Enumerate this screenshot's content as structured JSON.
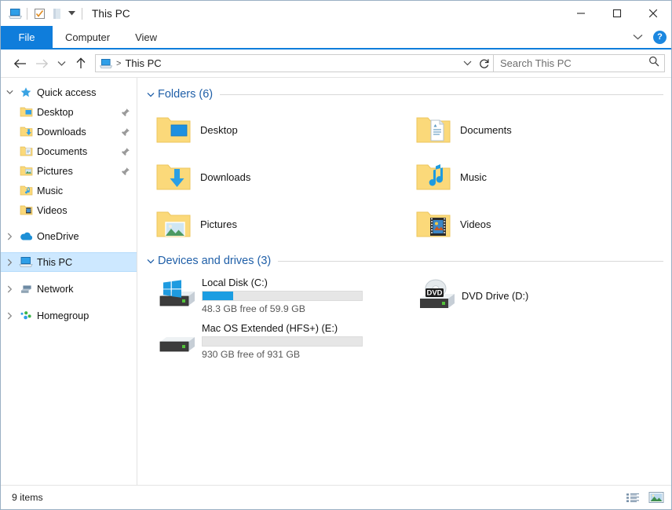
{
  "window": {
    "title": "This PC",
    "quick_access_toolbar": [
      {
        "name": "this-pc-icon",
        "label": "This PC"
      },
      {
        "name": "properties-icon",
        "label": "Properties"
      },
      {
        "name": "new-folder-icon",
        "label": "New folder"
      },
      {
        "name": "customize-chevron-icon",
        "label": "Customize Quick Access Toolbar"
      }
    ],
    "controls": {
      "minimize": "Minimize",
      "maximize": "Maximize",
      "close": "Close"
    }
  },
  "ribbon": {
    "tabs": [
      {
        "label": "File",
        "active": true
      },
      {
        "label": "Computer",
        "active": false
      },
      {
        "label": "View",
        "active": false
      }
    ],
    "expand_label": "Expand the Ribbon",
    "help_label": "?"
  },
  "navigation": {
    "back_label": "Back",
    "forward_label": "Forward",
    "recent_label": "Recent locations",
    "up_label": "Up",
    "breadcrumb": {
      "icon": "this-pc-icon",
      "separator": ">",
      "path": "This PC"
    },
    "address_dropdown_label": "Previous locations",
    "refresh_label": "Refresh"
  },
  "search": {
    "placeholder": "Search This PC",
    "value": "",
    "icon": "search-icon"
  },
  "sidebar": {
    "items": [
      {
        "label": "Quick access",
        "icon": "star-icon",
        "twisty": "down",
        "level": 0,
        "selected": false,
        "pinned": false
      },
      {
        "label": "Desktop",
        "icon": "folder-desktop-icon",
        "twisty": "none",
        "level": 1,
        "selected": false,
        "pinned": true
      },
      {
        "label": "Downloads",
        "icon": "folder-downloads-icon",
        "twisty": "none",
        "level": 1,
        "selected": false,
        "pinned": true
      },
      {
        "label": "Documents",
        "icon": "folder-documents-icon",
        "twisty": "none",
        "level": 1,
        "selected": false,
        "pinned": true
      },
      {
        "label": "Pictures",
        "icon": "folder-pictures-icon",
        "twisty": "none",
        "level": 1,
        "selected": false,
        "pinned": true
      },
      {
        "label": "Music",
        "icon": "folder-music-icon",
        "twisty": "none",
        "level": 1,
        "selected": false,
        "pinned": false
      },
      {
        "label": "Videos",
        "icon": "folder-videos-icon",
        "twisty": "none",
        "level": 1,
        "selected": false,
        "pinned": false
      },
      {
        "label": "OneDrive",
        "icon": "onedrive-cloud-icon",
        "twisty": "right",
        "level": 0,
        "selected": false,
        "pinned": false
      },
      {
        "label": "This PC",
        "icon": "this-pc-icon",
        "twisty": "right",
        "level": 0,
        "selected": true,
        "pinned": false
      },
      {
        "label": "Network",
        "icon": "network-icon",
        "twisty": "right",
        "level": 0,
        "selected": false,
        "pinned": false
      },
      {
        "label": "Homegroup",
        "icon": "homegroup-icon",
        "twisty": "right",
        "level": 0,
        "selected": false,
        "pinned": false
      }
    ]
  },
  "main": {
    "groups": [
      {
        "title": "Folders (6)",
        "expanded": true,
        "items": [
          {
            "label": "Desktop",
            "icon": "folder-desktop-icon"
          },
          {
            "label": "Documents",
            "icon": "folder-documents-icon"
          },
          {
            "label": "Downloads",
            "icon": "folder-downloads-icon"
          },
          {
            "label": "Music",
            "icon": "folder-music-icon"
          },
          {
            "label": "Pictures",
            "icon": "folder-pictures-icon"
          },
          {
            "label": "Videos",
            "icon": "folder-videos-icon"
          }
        ]
      },
      {
        "title": "Devices and drives (3)",
        "expanded": true,
        "drives": [
          {
            "name": "Local Disk (C:)",
            "icon": "windows-drive-icon",
            "has_meter": true,
            "free_text": "48.3 GB free of 59.9 GB",
            "free_gb": 48.3,
            "total_gb": 59.9,
            "used_percent": 19,
            "fill_color": "#1b9de2"
          },
          {
            "name": "DVD Drive (D:)",
            "icon": "dvd-drive-icon",
            "has_meter": false,
            "free_text": "",
            "badge": "DVD"
          },
          {
            "name": "Mac OS Extended (HFS+) (E:)",
            "icon": "hard-drive-icon",
            "has_meter": true,
            "free_text": "930 GB free of 931 GB",
            "free_gb": 930,
            "total_gb": 931,
            "used_percent": 0,
            "fill_color": "#1b9de2"
          }
        ]
      }
    ]
  },
  "statusbar": {
    "item_count": "9 items",
    "views": [
      {
        "name": "details-view-button",
        "label": "Details view"
      },
      {
        "name": "large-icons-view-button",
        "label": "Large icons view"
      }
    ]
  },
  "colors": {
    "accent": "#0f7ddb",
    "selection": "#cde8ff",
    "group_header": "#1f5fa8",
    "meter_fill": "#1b9de2",
    "folder_yellow": "#fbd97a"
  }
}
